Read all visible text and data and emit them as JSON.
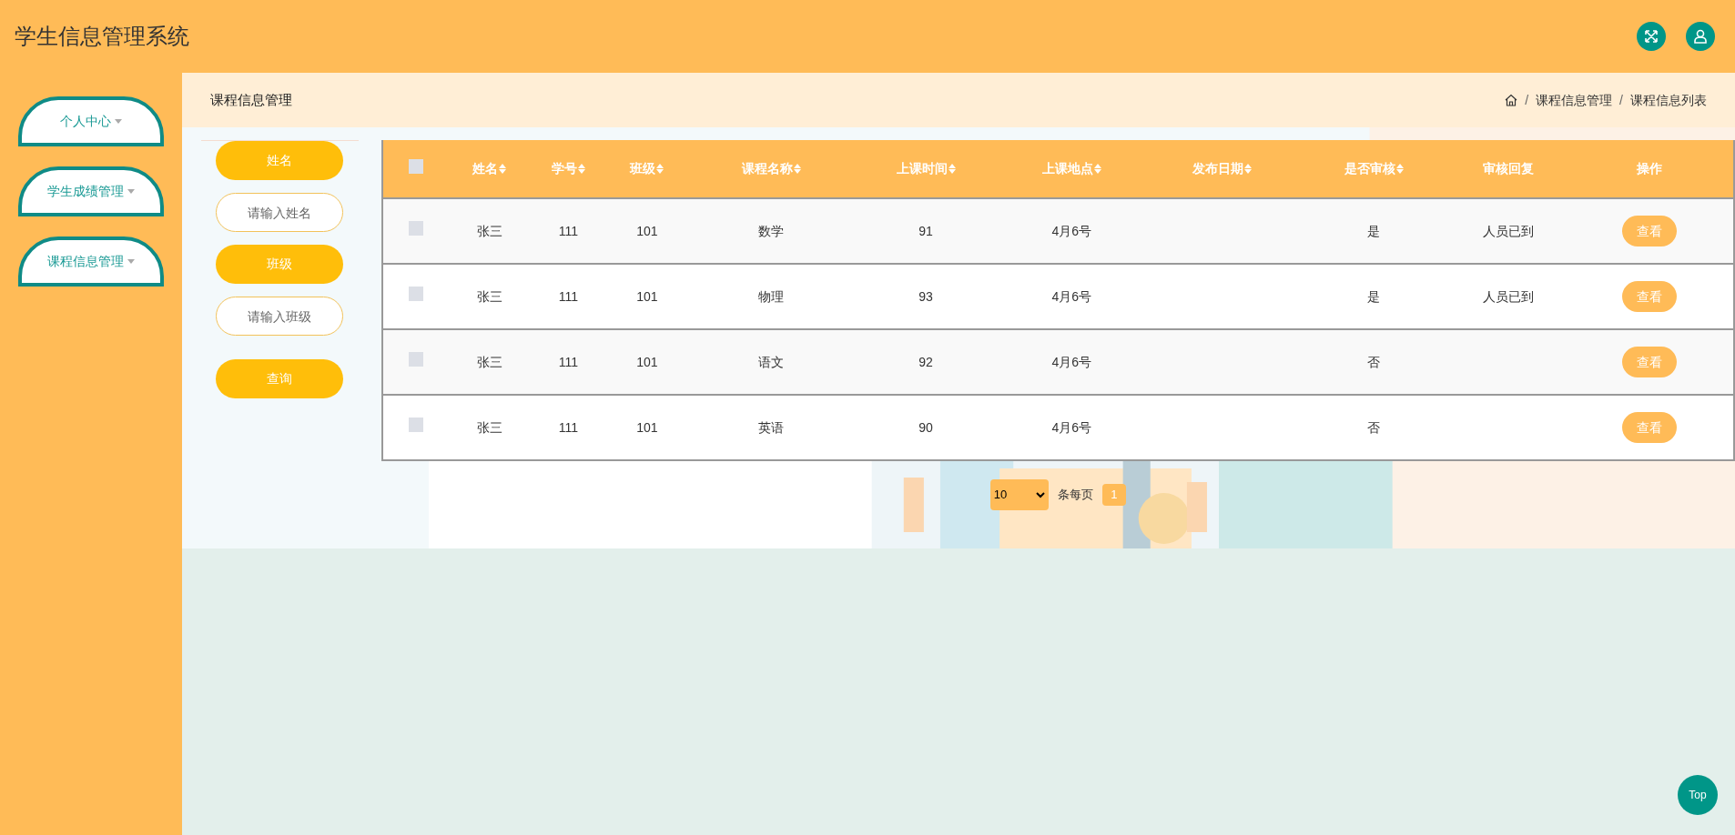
{
  "header": {
    "title": "学生信息管理系统"
  },
  "sidebar": {
    "items": [
      {
        "label": "个人中心"
      },
      {
        "label": "学生成绩管理"
      },
      {
        "label": "课程信息管理"
      }
    ]
  },
  "page_title": "课程信息管理",
  "breadcrumb": [
    "课程信息管理",
    "课程信息列表"
  ],
  "breadcrumb_separator": "/",
  "search": [
    {
      "kind": "label",
      "text": "姓名"
    },
    {
      "kind": "input",
      "placeholder": "请输入姓名"
    },
    {
      "kind": "label",
      "text": "班级"
    },
    {
      "kind": "input",
      "placeholder": "请输入班级"
    },
    {
      "kind": "button",
      "text": "查询"
    }
  ],
  "table": {
    "select_all": {
      "checked": false
    },
    "columns": [
      {
        "label": "姓名",
        "sortable": true
      },
      {
        "label": "学号",
        "sortable": true
      },
      {
        "label": "班级",
        "sortable": true
      },
      {
        "label": "课程名称",
        "sortable": true
      },
      {
        "label": "上课时间",
        "sortable": true
      },
      {
        "label": "上课地点",
        "sortable": true
      },
      {
        "label": "发布日期",
        "sortable": true
      },
      {
        "label": "是否审核",
        "sortable": true
      },
      {
        "label": "审核回复",
        "sortable": false
      },
      {
        "label": "操作",
        "sortable": false
      }
    ],
    "rows": [
      {
        "checked": false,
        "cells": [
          "张三",
          "111",
          "101",
          "数学",
          "91",
          "4月6号",
          "",
          "是",
          "人员已到"
        ],
        "action": "查看"
      },
      {
        "checked": false,
        "cells": [
          "张三",
          "111",
          "101",
          "物理",
          "93",
          "4月6号",
          "",
          "是",
          "人员已到"
        ],
        "action": "查看"
      },
      {
        "checked": false,
        "cells": [
          "张三",
          "111",
          "101",
          "语文",
          "92",
          "4月6号",
          "",
          "否",
          ""
        ],
        "action": "查看"
      },
      {
        "checked": false,
        "cells": [
          "张三",
          "111",
          "101",
          "英语",
          "90",
          "4月6号",
          "",
          "否",
          ""
        ],
        "action": "查看"
      }
    ]
  },
  "pagination": {
    "page_size": "10",
    "page_size_label": "条每页",
    "pages": [
      {
        "label": "1",
        "selected": true
      }
    ]
  },
  "top_button": "Top"
}
